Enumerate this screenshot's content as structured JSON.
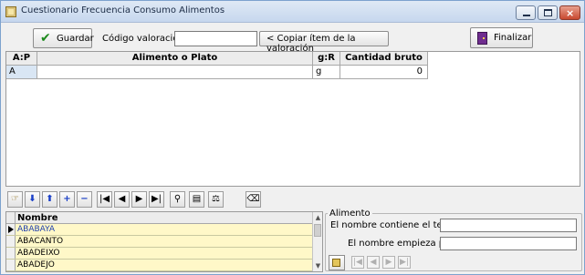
{
  "window": {
    "title": "Cuestionario Frecuencia Consumo Alimentos",
    "minimize_glyph": "",
    "maximize_glyph": "",
    "close_glyph": "×"
  },
  "toolbar": {
    "save_label": "Guardar",
    "code_label": "Código valoración",
    "code_value": "",
    "copy_label": "< Copiar ítem de la valoración",
    "finish_label": "Finalizar"
  },
  "grid": {
    "columns": [
      "A:P",
      "Alimento o Plato",
      "g:R",
      "Cantidad bruto"
    ],
    "rows": [
      {
        "ap": "A",
        "food": "",
        "gr": "g",
        "qty": "0"
      }
    ]
  },
  "navigator": {
    "buttons": [
      "pointer-icon",
      "arrow-down-icon",
      "arrow-up-icon",
      "plus-icon",
      "minus-icon",
      "first-icon",
      "prev-icon",
      "next-icon",
      "last-icon",
      "binoculars-icon",
      "clipboard-icon",
      "scale-icon",
      "trash-icon"
    ],
    "glyphs": {
      "pointer": "☞",
      "down": "⬇",
      "up": "⬆",
      "plus": "+",
      "minus": "−",
      "first": "|◀",
      "prev": "◀",
      "next": "▶",
      "last": "▶|",
      "find": "⚲",
      "clipboard": "▤",
      "scale": "⚖",
      "trash": "⌫"
    }
  },
  "list": {
    "header": "Nombre",
    "items": [
      "ABABAYA",
      "ABACANTO",
      "ABADEIXO",
      "ABADEJO"
    ],
    "selected_index": 0
  },
  "search": {
    "group_title": "Alimento",
    "contains_label": "El nombre contiene el texto",
    "contains_value": "",
    "starts_label": "El nombre empieza por",
    "starts_value": "",
    "nav_glyphs": [
      "|◀",
      "◀",
      "▶",
      "▶|"
    ]
  }
}
